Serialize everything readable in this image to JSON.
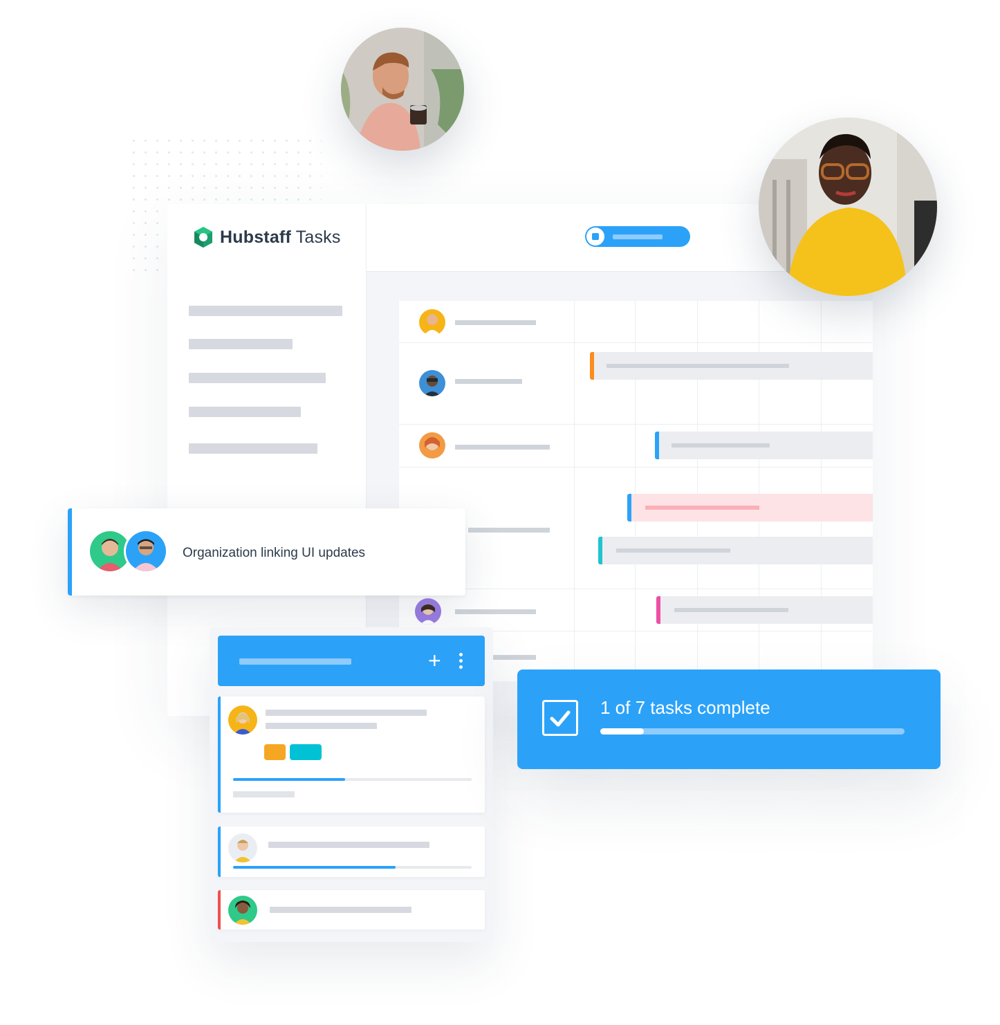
{
  "brand": {
    "name_bold": "Hubstaff",
    "name_light": " Tasks",
    "logo_icon": "hubstaff-logo-icon",
    "accent_color": "#2ba2f8"
  },
  "task_card": {
    "title": "Organization linking UI updates",
    "assignees": [
      "avatar-man-smiling",
      "avatar-man-glasses"
    ]
  },
  "completion": {
    "label": "1 of 7 tasks complete",
    "completed": 1,
    "total": 7,
    "icon": "checkbox-checked-icon"
  },
  "kanban": {
    "add_icon": "+",
    "more_icon": "more-vertical-icon",
    "cards": [
      {
        "tags": [
          "#f5a623",
          "#00c2d4"
        ],
        "progress": 0.47,
        "edge": "#2ba2f8"
      },
      {
        "progress": 0.68,
        "edge": "#2ba2f8"
      },
      {
        "edge": "#f04e4e"
      }
    ]
  },
  "gantt": {
    "bar_colors": [
      "#fb8c1e",
      "#2ba2f8",
      "#2ba2f8",
      "#1fc4cf",
      "#ee4fa6"
    ]
  }
}
